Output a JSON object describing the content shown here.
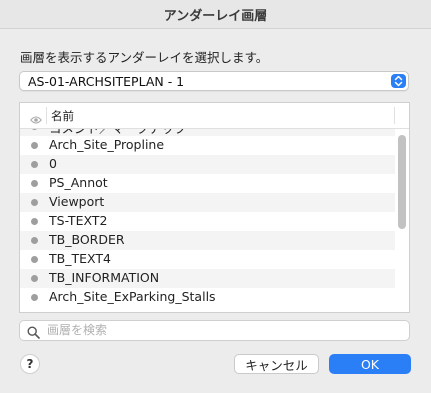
{
  "window": {
    "title": "アンダーレイ画層"
  },
  "prompt": "画層を表示するアンダーレイを選択します。",
  "underlay_select": {
    "value": "AS-01-ARCHSITEPLAN - 1"
  },
  "layer_list": {
    "header": {
      "name_label": "名前"
    },
    "rows": [
      "コメント／マークアップ",
      "Arch_Site_Propline",
      "0",
      "PS_Annot",
      "Viewport",
      "TS-TEXT2",
      "TB_BORDER",
      "TB_TEXT4",
      "TB_INFORMATION",
      "Arch_Site_ExParking_Stalls"
    ]
  },
  "search": {
    "placeholder": "画層を検索",
    "value": ""
  },
  "buttons": {
    "help": "?",
    "cancel": "キャンセル",
    "ok": "OK"
  },
  "colors": {
    "accent": "#2a7ff7",
    "dialog_bg": "#ececec",
    "dot": "#9e9e9e"
  }
}
